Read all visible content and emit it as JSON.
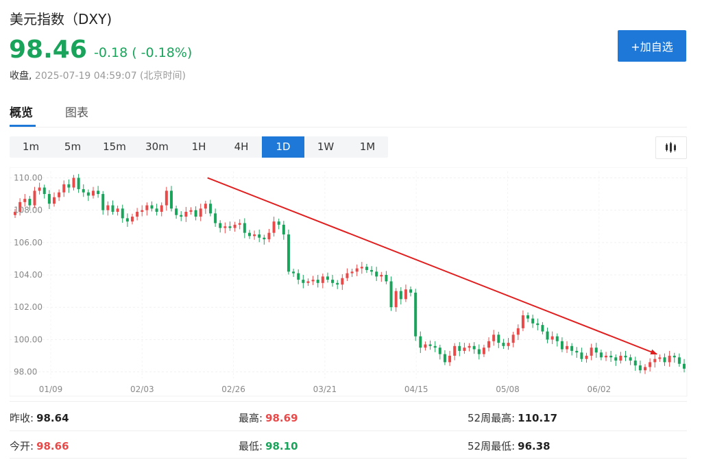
{
  "header": {
    "title": "美元指数（DXY)",
    "price": "98.46",
    "change": "-0.18 ( -0.18%)",
    "close_label": "收盘,",
    "close_time": "2025-07-19 04:59:07 (北京时间)",
    "add_button": "+加自选"
  },
  "tabs": [
    {
      "label": "概览",
      "active": true
    },
    {
      "label": "图表",
      "active": false
    }
  ],
  "periods": [
    {
      "label": "1m",
      "active": false
    },
    {
      "label": "5m",
      "active": false
    },
    {
      "label": "15m",
      "active": false
    },
    {
      "label": "30m",
      "active": false
    },
    {
      "label": "1H",
      "active": false
    },
    {
      "label": "4H",
      "active": false
    },
    {
      "label": "1D",
      "active": true
    },
    {
      "label": "1W",
      "active": false
    },
    {
      "label": "1M",
      "active": false
    }
  ],
  "chart_type_icon": "candlestick-icon",
  "colors": {
    "accent": "#1e78d8",
    "up": "#e84a4a",
    "down": "#1aa35b",
    "arrow": "#e02020"
  },
  "chart_data": {
    "type": "candlestick",
    "ylim": [
      97.6,
      110.4
    ],
    "yticks": [
      "110.00",
      "108.00",
      "106.00",
      "104.00",
      "102.00",
      "100.00",
      "98.00"
    ],
    "xticks": [
      "01/09",
      "02/03",
      "02/26",
      "03/21",
      "04/15",
      "05/08",
      "06/02"
    ],
    "closes": [
      107.9,
      108.5,
      108.7,
      108.3,
      109.2,
      109.4,
      109.0,
      108.4,
      108.8,
      109.1,
      109.6,
      109.4,
      110.0,
      109.3,
      109.1,
      108.9,
      109.2,
      109.0,
      108.0,
      108.3,
      107.9,
      108.1,
      107.5,
      107.3,
      107.6,
      107.9,
      108.0,
      108.3,
      108.1,
      107.9,
      108.3,
      109.2,
      108.1,
      107.7,
      107.6,
      107.9,
      108.0,
      107.6,
      108.1,
      108.4,
      107.8,
      107.2,
      106.9,
      107.0,
      106.9,
      107.1,
      107.2,
      106.6,
      106.4,
      106.5,
      106.3,
      106.2,
      106.6,
      107.3,
      107.1,
      106.5,
      104.2,
      104.1,
      103.7,
      103.5,
      103.6,
      103.7,
      103.5,
      103.9,
      103.7,
      103.5,
      103.4,
      103.8,
      104.1,
      104.2,
      104.4,
      104.5,
      104.3,
      104.2,
      103.9,
      104.0,
      103.6,
      102.0,
      103.0,
      102.5,
      103.1,
      102.9,
      100.2,
      99.5,
      99.7,
      99.6,
      99.5,
      99.1,
      98.6,
      99.0,
      99.6,
      99.3,
      99.5,
      99.6,
      99.4,
      99.1,
      99.5,
      99.9,
      100.3,
      99.8,
      99.6,
      99.8,
      100.3,
      100.7,
      101.5,
      101.3,
      101.0,
      100.9,
      100.5,
      100.0,
      100.2,
      99.9,
      99.4,
      99.6,
      99.3,
      99.2,
      98.8,
      99.0,
      99.5,
      99.2,
      98.9,
      99.0,
      98.9,
      98.7,
      99.0,
      98.9,
      98.7,
      98.4,
      98.1,
      98.3,
      98.6,
      98.8,
      98.9,
      98.6,
      99.0,
      98.9,
      98.5,
      98.2
    ],
    "trend_arrow": {
      "from": {
        "index": 38,
        "value": 110.0
      },
      "to": {
        "index": 130,
        "value": 99.1
      }
    }
  },
  "stats": [
    {
      "label": "昨收:",
      "value": "98.64",
      "tone": "black"
    },
    {
      "label": "最高:",
      "value": "98.69",
      "tone": "red"
    },
    {
      "label": "52周最高:",
      "value": "110.17",
      "tone": "black"
    },
    {
      "label": "今开:",
      "value": "98.66",
      "tone": "red"
    },
    {
      "label": "最低:",
      "value": "98.10",
      "tone": "green"
    },
    {
      "label": "52周最低:",
      "value": "96.38",
      "tone": "black"
    }
  ]
}
